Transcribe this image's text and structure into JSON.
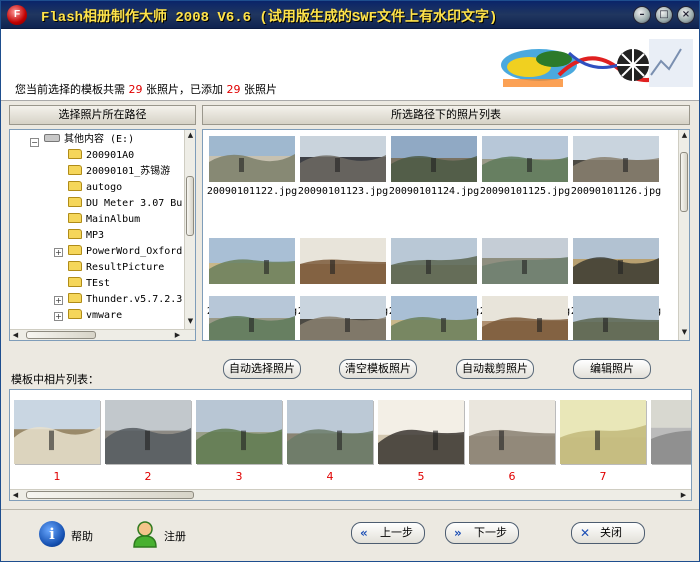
{
  "window": {
    "title": "Flash相册制作大师 2008 V6.6 (试用版生成的SWF文件上有水印文字)",
    "icon_name": "flash-app-icon",
    "controls": [
      "minimize-icon",
      "maximize-icon",
      "close-icon"
    ]
  },
  "header": {
    "status_prefix": "您当前选择的模板共需",
    "required_count": "29",
    "status_mid": "张照片，已添加",
    "added_count": "29",
    "status_suffix": "张照片"
  },
  "folder_panel": {
    "title": "选择照片所在路径",
    "drive_label": "其他内容 (E:)",
    "folders": [
      {
        "name": "200901A0",
        "expandable": false
      },
      {
        "name": "20090101_苏锡游",
        "expandable": false
      },
      {
        "name": "autogo",
        "expandable": false
      },
      {
        "name": "DU Meter 3.07 Bu",
        "expandable": false
      },
      {
        "name": "MainAlbum",
        "expandable": false
      },
      {
        "name": "MP3",
        "expandable": false
      },
      {
        "name": "PowerWord_Oxford",
        "expandable": true
      },
      {
        "name": "ResultPicture",
        "expandable": false
      },
      {
        "name": "TEst",
        "expandable": false
      },
      {
        "name": "Thunder.v5.7.2.3",
        "expandable": true
      },
      {
        "name": "vmware",
        "expandable": true
      }
    ]
  },
  "photo_panel": {
    "title": "所选路径下的照片列表",
    "photos": [
      "20090101122.jpg",
      "20090101123.jpg",
      "20090101124.jpg",
      "20090101125.jpg",
      "20090101126.jpg",
      "20090101127.jpg",
      "20090101128.jpg",
      "20090101129.jpg",
      "20090101130.jpg",
      "20090101131.jpg"
    ]
  },
  "actions": {
    "auto_select": "自动选择照片",
    "clear_template": "清空模板照片",
    "auto_crop": "自动裁剪照片",
    "edit_photo": "编辑照片"
  },
  "template_strip": {
    "label": "模板中相片列表：",
    "numbers": [
      "1",
      "2",
      "3",
      "4",
      "5",
      "6",
      "7"
    ]
  },
  "footer": {
    "help": "帮助",
    "register": "注册",
    "prev": "上一步",
    "next": "下一步",
    "close": "关闭"
  },
  "colors": {
    "title_bar": "#0a246a",
    "title_text": "#ffe34a",
    "count_highlight": "#e00000",
    "frame": "#ece9e1"
  }
}
